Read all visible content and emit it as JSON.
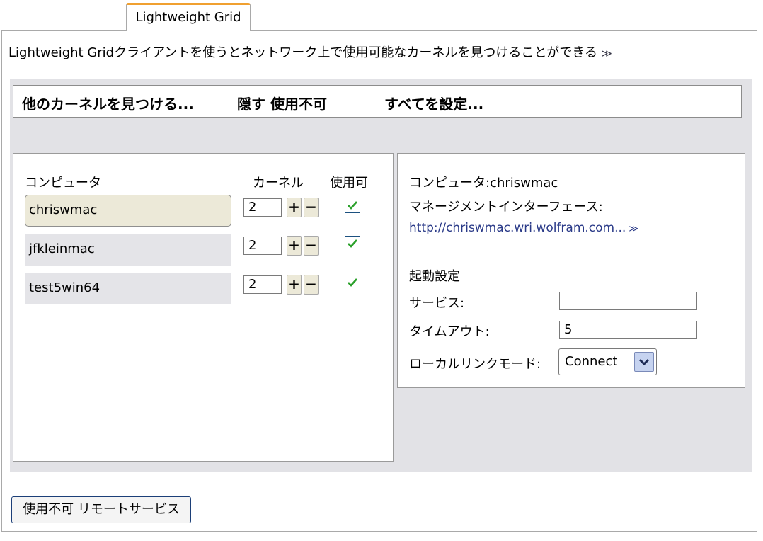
{
  "tab": {
    "label": "Lightweight Grid"
  },
  "description": {
    "text": "Lightweight Gridクライアントを使うとネットワーク上で使用可能なカーネルを見つけることができる",
    "more": "≫"
  },
  "toolbar": {
    "find_label": "他のカーネルを見つける...",
    "hide_label": "隠す 使用不可",
    "set_all_label": "すべてを設定..."
  },
  "table": {
    "headers": {
      "computer": "コンピュータ",
      "kernels": "カーネル",
      "enabled": "使用可"
    },
    "rows": [
      {
        "name": "chriswmac",
        "kernels": "2",
        "enabled": true
      },
      {
        "name": "jfkleinmac",
        "kernels": "2",
        "enabled": true
      },
      {
        "name": "test5win64",
        "kernels": "2",
        "enabled": true
      }
    ],
    "plus": "+",
    "minus": "−"
  },
  "details": {
    "computer_label": "コンピュータ:",
    "computer_value": "chriswmac",
    "mgmt_label": "マネージメントインターフェース:",
    "mgmt_url": "http://chriswmac.wri.wolfram.com...",
    "mgmt_more": "≫",
    "startup_title": "起動設定",
    "service_label": "サービス:",
    "service_value": "",
    "timeout_label": "タイムアウト:",
    "timeout_value": "5",
    "linkmode_label": "ローカルリンクモード:",
    "linkmode_value": "Connect"
  },
  "bottom": {
    "disable_remote_label": "使用不可 リモートサービス"
  },
  "colors": {
    "tab_accent": "#f0a030",
    "check": "#2aa02a",
    "link": "#2a3a88"
  },
  "icons": {
    "checkbox": "check-icon",
    "dropdown": "chevron-down-icon"
  }
}
